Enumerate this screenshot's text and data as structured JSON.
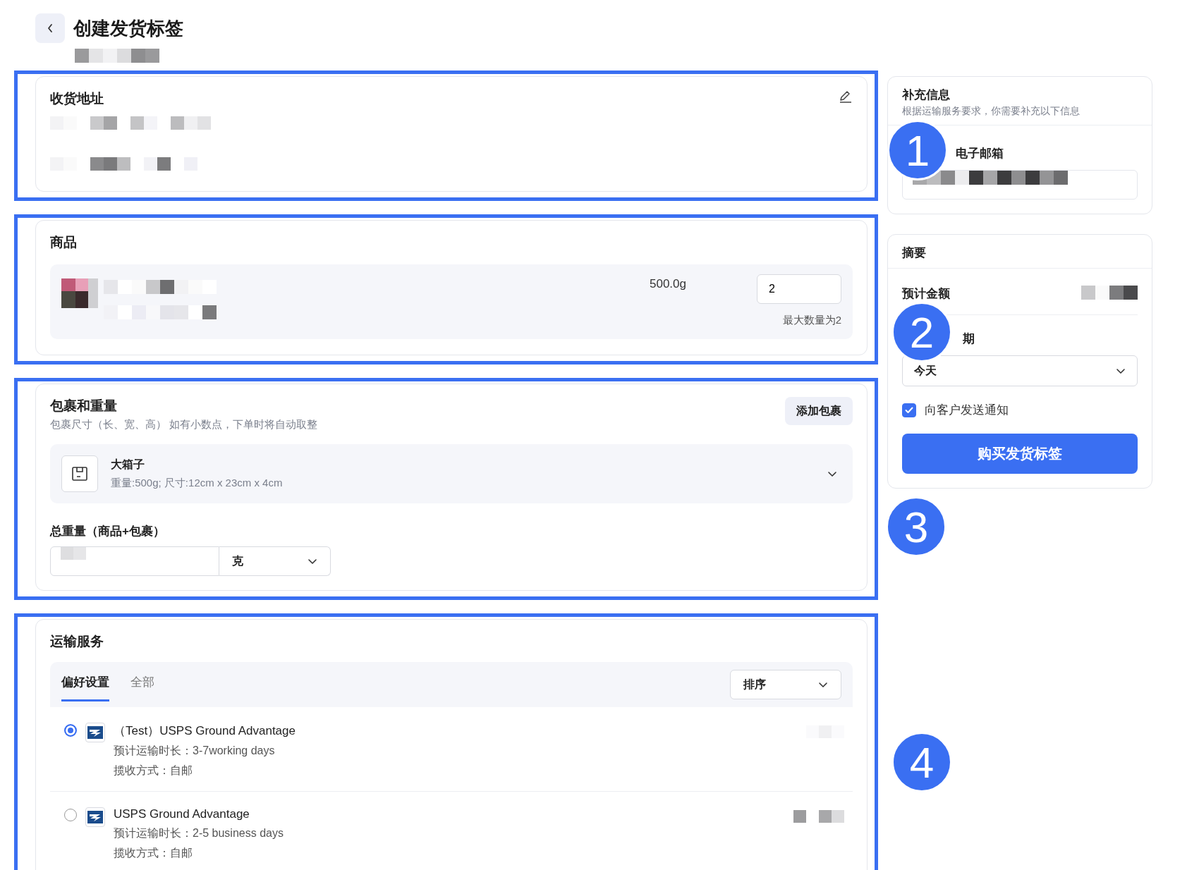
{
  "header": {
    "title": "创建发货标签"
  },
  "address": {
    "title": "收货地址"
  },
  "products": {
    "title": "商品",
    "items": [
      {
        "weight": "500.0g",
        "quantity": "2",
        "max_note": "最大数量为2"
      }
    ]
  },
  "package": {
    "title": "包裹和重量",
    "subtitle": "包裹尺寸（长、宽、高） 如有小数点，下单时将自动取整",
    "add_button": "添加包裹",
    "box": {
      "name": "大箱子",
      "details": "重量:500g; 尺寸:12cm x 23cm x 4cm"
    },
    "total_label": "总重量（商品+包裹）",
    "unit": "克"
  },
  "shipping": {
    "title": "运输服务",
    "tabs": [
      {
        "label": "偏好设置",
        "selected": true
      },
      {
        "label": "全部",
        "selected": false
      }
    ],
    "sort": "排序",
    "services": [
      {
        "name": "（Test）USPS Ground Advantage",
        "duration": "预计运输时长：3-7working days",
        "pickup": "揽收方式：自邮",
        "selected": true
      },
      {
        "name": "USPS Ground Advantage",
        "duration": "预计运输时长：2-5 business days",
        "pickup": "揽收方式：自邮",
        "selected": false
      }
    ]
  },
  "extra_info": {
    "title": "补充信息",
    "subtitle": "根据运输服务要求，你需要补充以下信息",
    "email_label": "电子邮箱"
  },
  "summary": {
    "title": "摘要",
    "amount_label": "预计金额",
    "date_label": "期",
    "date_value": "今天",
    "notify": {
      "label": "向客户发送通知",
      "checked": true
    },
    "buy_button": "购买发货标签"
  },
  "annotations": [
    {
      "label": "1"
    },
    {
      "label": "2"
    },
    {
      "label": "3"
    },
    {
      "label": "4"
    }
  ]
}
